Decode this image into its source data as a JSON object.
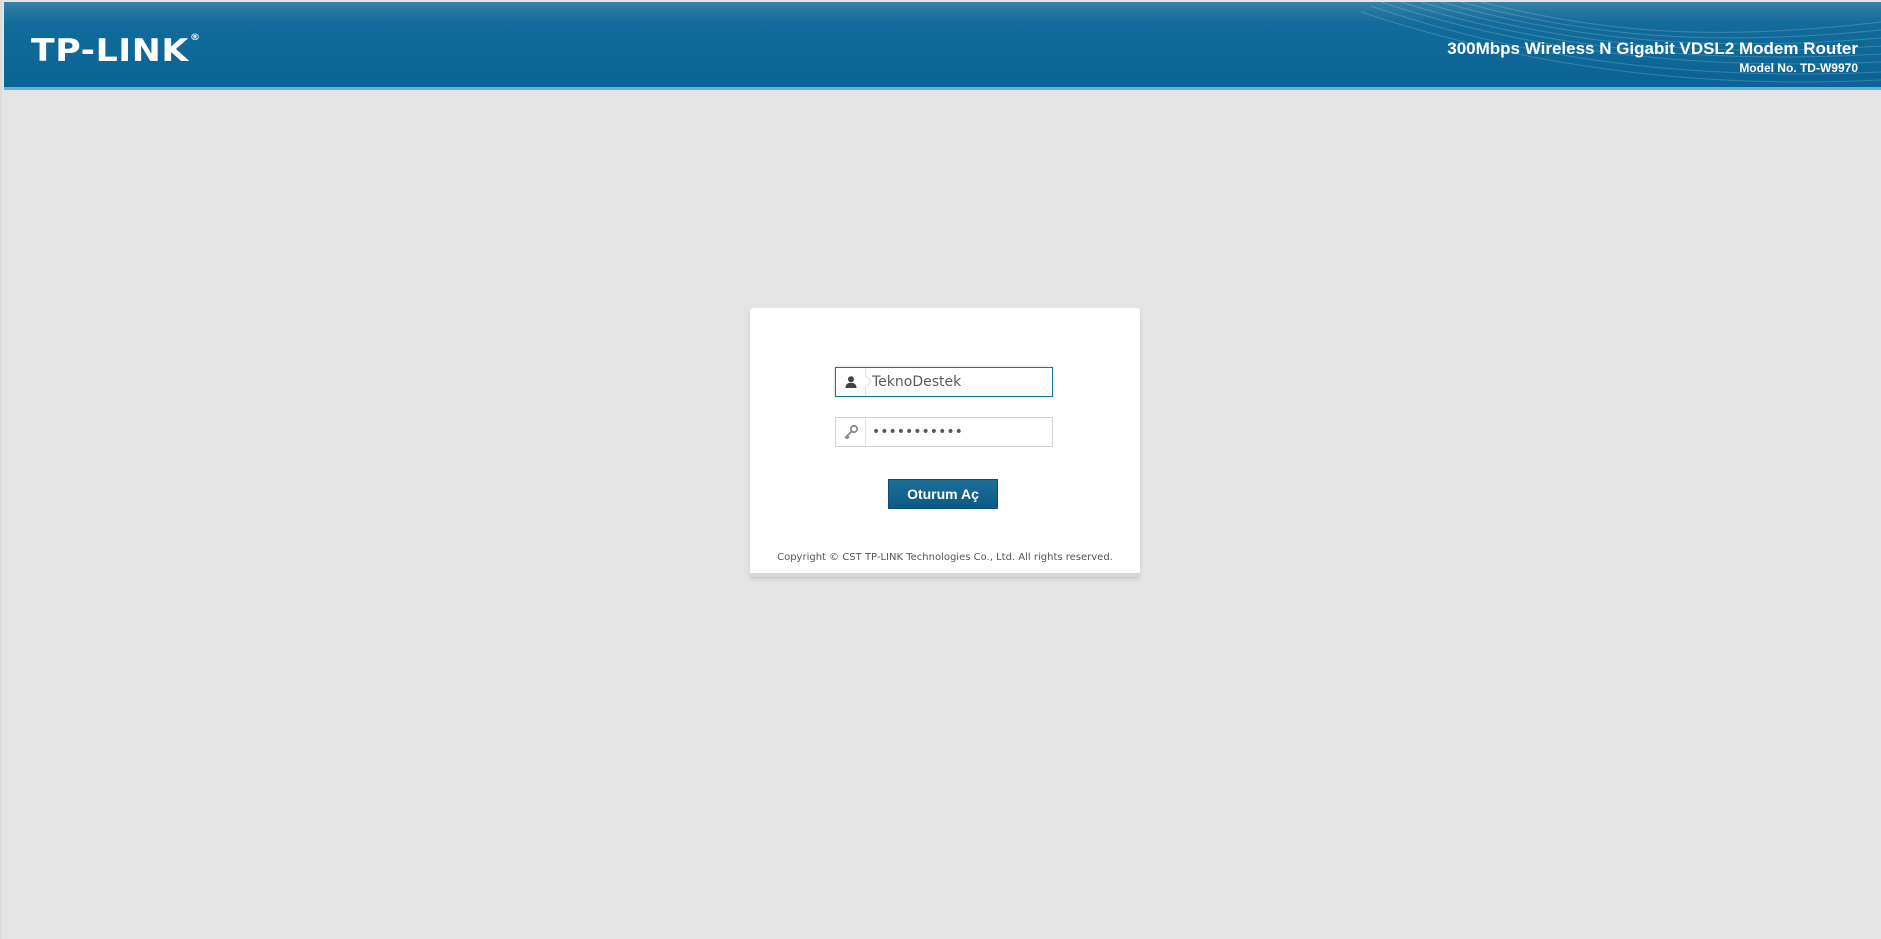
{
  "header": {
    "logo_text": "TP-LINK",
    "logo_mark": "®",
    "product_title": "300Mbps Wireless N Gigabit VDSL2 Modem Router",
    "model_no": "Model No. TD-W9970"
  },
  "login": {
    "username_value": "TeknoDestek",
    "username_icon": "user-icon",
    "password_value": "•••••••••••",
    "password_icon": "key-icon",
    "submit_label": "Oturum Aç"
  },
  "footer": {
    "copyright": "Copyright © CST TP-LINK Technologies Co., Ltd. All rights reserved."
  },
  "colors": {
    "banner": "#0f6a99",
    "button": "#0d5b84",
    "background": "#e4e4e4"
  }
}
